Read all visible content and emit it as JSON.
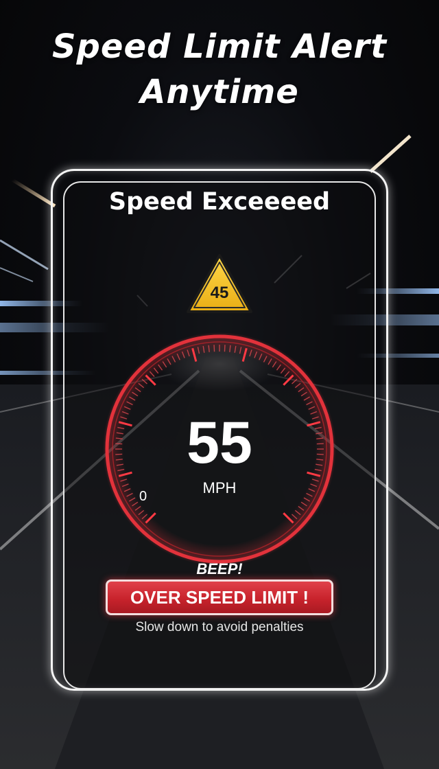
{
  "headline": {
    "line1": "Speed Limit Alert",
    "line2": "Anytime"
  },
  "screen": {
    "title": "Speed Exceeeed",
    "speed_limit": "45",
    "current_speed": "55",
    "unit": "MPH",
    "gauge_zero_label": "0",
    "beep_label": "BEEP!",
    "alert_button_label": "OVER SPEED LIMIT !",
    "advice": "Slow down to avoid penalties"
  },
  "icons": {
    "warning": "warning-triangle-icon"
  },
  "colors": {
    "accent_red": "#d92a33",
    "gauge_red": "#e2323b",
    "warning_yellow": "#f2c12e",
    "frame_white": "#f4f4f4"
  }
}
